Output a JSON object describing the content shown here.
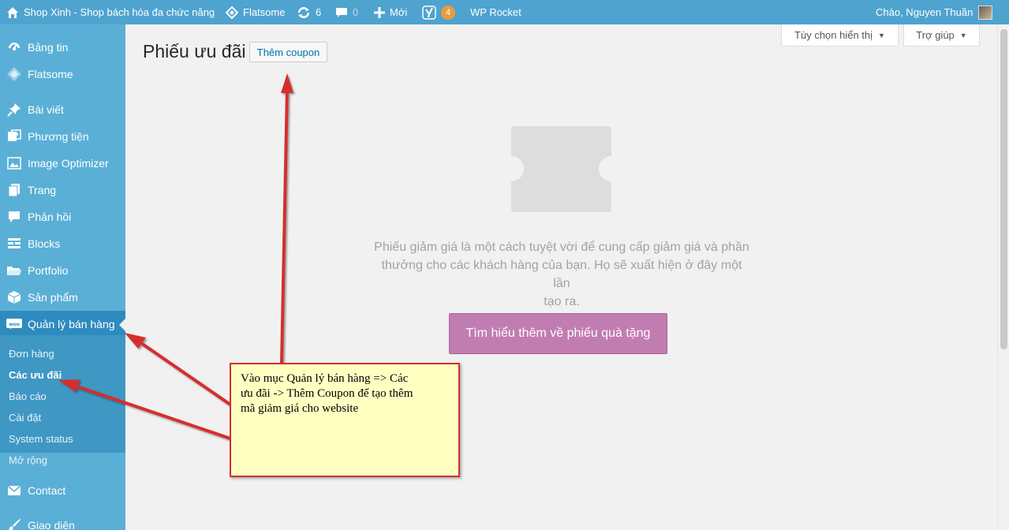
{
  "adminbar": {
    "site_name": "Shop Xinh - Shop bách hóa đa chức năng",
    "flatsome": "Flatsome",
    "updates_count": "6",
    "comments_count": "0",
    "new_label": "Mới",
    "yoast_count": "4",
    "wp_rocket": "WP Rocket",
    "greeting": "Chào, Nguyen Thuần"
  },
  "sidebar": {
    "items": [
      {
        "label": "Bảng tin",
        "icon": "dashboard-icon"
      },
      {
        "label": "Flatsome",
        "icon": "flatsome-icon"
      },
      {
        "label": "Bài viết",
        "icon": "pin-icon"
      },
      {
        "label": "Phương tiện",
        "icon": "media-icon"
      },
      {
        "label": "Image Optimizer",
        "icon": "image-icon"
      },
      {
        "label": "Trang",
        "icon": "page-icon"
      },
      {
        "label": "Phản hồi",
        "icon": "comment-icon"
      },
      {
        "label": "Blocks",
        "icon": "blocks-icon"
      },
      {
        "label": "Portfolio",
        "icon": "folder-icon"
      },
      {
        "label": "Sản phẩm",
        "icon": "box-icon"
      },
      {
        "label": "Quản lý bán hàng",
        "icon": "woo-icon"
      },
      {
        "label": "Contact",
        "icon": "mail-icon"
      },
      {
        "label": "Giao diện",
        "icon": "brush-icon"
      }
    ],
    "submenu": [
      "Đơn hàng",
      "Các ưu đãi",
      "Báo cáo",
      "Cài đặt",
      "System status",
      "Mở rộng"
    ]
  },
  "main": {
    "title": "Phiếu ưu đãi",
    "add_button": "Thêm coupon",
    "screen_options": "Tùy chọn hiển thị",
    "help": "Trợ giúp",
    "empty_line1": "Phiếu giảm giá là một cách tuyệt vời để cung cấp giảm giá và phần",
    "empty_line2": "thưởng cho các khách hàng của bạn. Họ sẽ xuất hiện ở đây một lần",
    "empty_line3": "tạo ra.",
    "learn_more": "Tìm hiểu thêm về phiếu quà tặng"
  },
  "annotation": {
    "line1": "Vào mục Quản lý bán hàng => Các",
    "line2": "ưu đãi -> Thêm Coupon để tạo thêm",
    "line3": "mã giảm giá cho website"
  },
  "colors": {
    "adminbar": "#4fa3cf",
    "sidebar": "#5aafd6",
    "active": "#2e8bbf",
    "button_purple": "#c17db1",
    "annotation_border": "#d52f2f"
  }
}
